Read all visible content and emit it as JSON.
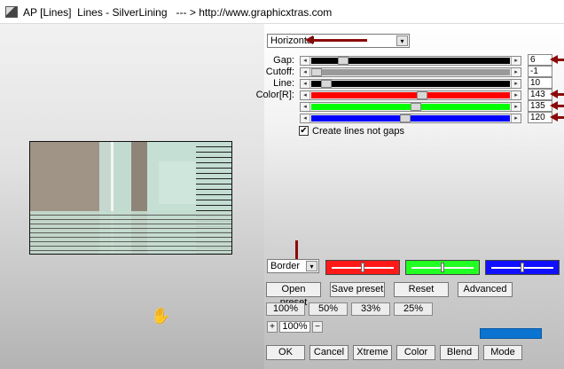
{
  "window": {
    "title": "AP [Lines]  Lines - SilverLining   --- > http://www.graphicxtras.com"
  },
  "direction_select": {
    "value": "Horizontal"
  },
  "params": [
    {
      "label": "Gap:",
      "value": "6",
      "fraction": 0.14
    },
    {
      "label": "Cutoff:",
      "value": "-1",
      "fraction": 0.0
    },
    {
      "label": "Line:",
      "value": "10",
      "fraction": 0.05
    },
    {
      "label": "Color[R]:",
      "value": "143",
      "fraction": 0.56
    },
    {
      "label": "",
      "value": "135",
      "fraction": 0.53
    },
    {
      "label": "",
      "value": "120",
      "fraction": 0.47
    }
  ],
  "create_lines_checkbox": {
    "label": "Create lines not gaps",
    "checked": true,
    "mark": "✔"
  },
  "mode_select": {
    "value": "Border"
  },
  "color_swatches": [
    {
      "name": "red",
      "color": "#ff1a1a",
      "level": 0.5
    },
    {
      "name": "green",
      "color": "#22ff22",
      "level": 0.5
    },
    {
      "name": "blue",
      "color": "#1010ff",
      "level": 0.5
    }
  ],
  "buttons": {
    "open_preset": "Open preset",
    "save_preset": "Save preset",
    "reset": "Reset",
    "advanced": "Advanced",
    "ok": "OK",
    "cancel": "Cancel",
    "xtreme": "Xtreme",
    "color": "Color",
    "blend": "Blend",
    "mode": "Mode"
  },
  "zoom_presets": [
    "100%",
    "50%",
    "33%",
    "25%"
  ],
  "zoom": {
    "minus": "+",
    "value": "100%",
    "plus": "−"
  },
  "icons": {
    "dropdown": "▾",
    "left_arrow": "◂",
    "right_arrow": "▸",
    "hand": "✋"
  }
}
